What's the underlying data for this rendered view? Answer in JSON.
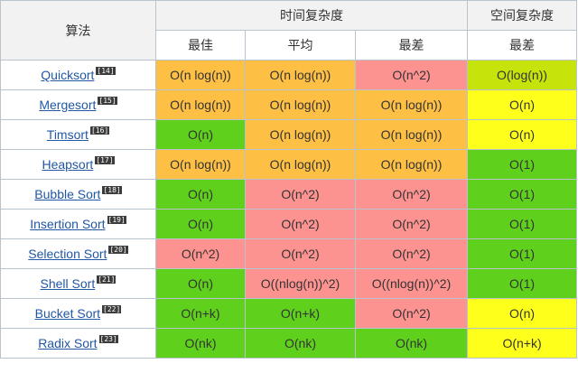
{
  "table": {
    "header": {
      "algorithm": "算法",
      "time": "时间复杂度",
      "space": "空间复杂度",
      "best": "最佳",
      "average": "平均",
      "worst": "最差",
      "space_worst": "最差"
    },
    "colors": {
      "green": "#5fd01c",
      "orange": "#fdbf44",
      "red": "#fd9391",
      "yellow": "#ffff1c",
      "lime": "#c6e40b",
      "link": "#2157a5",
      "border": "#b9c3ce"
    },
    "rows": [
      {
        "name": "Quicksort",
        "ref": "[14]",
        "cells": [
          {
            "v": "O(n log(n))",
            "c": "orange"
          },
          {
            "v": "O(n log(n))",
            "c": "orange"
          },
          {
            "v": "O(n^2)",
            "c": "red"
          },
          {
            "v": "O(log(n))",
            "c": "lime"
          }
        ]
      },
      {
        "name": "Mergesort",
        "ref": "[15]",
        "cells": [
          {
            "v": "O(n log(n))",
            "c": "orange"
          },
          {
            "v": "O(n log(n))",
            "c": "orange"
          },
          {
            "v": "O(n log(n))",
            "c": "orange"
          },
          {
            "v": "O(n)",
            "c": "yellow"
          }
        ]
      },
      {
        "name": "Timsort",
        "ref": "[16]",
        "cells": [
          {
            "v": "O(n)",
            "c": "green"
          },
          {
            "v": "O(n log(n))",
            "c": "orange"
          },
          {
            "v": "O(n log(n))",
            "c": "orange"
          },
          {
            "v": "O(n)",
            "c": "yellow"
          }
        ]
      },
      {
        "name": "Heapsort",
        "ref": "[17]",
        "cells": [
          {
            "v": "O(n log(n))",
            "c": "orange"
          },
          {
            "v": "O(n log(n))",
            "c": "orange"
          },
          {
            "v": "O(n log(n))",
            "c": "orange"
          },
          {
            "v": "O(1)",
            "c": "green"
          }
        ]
      },
      {
        "name": "Bubble Sort",
        "ref": "[18]",
        "cells": [
          {
            "v": "O(n)",
            "c": "green"
          },
          {
            "v": "O(n^2)",
            "c": "red"
          },
          {
            "v": "O(n^2)",
            "c": "red"
          },
          {
            "v": "O(1)",
            "c": "green"
          }
        ]
      },
      {
        "name": "Insertion Sort",
        "ref": "[19]",
        "cells": [
          {
            "v": "O(n)",
            "c": "green"
          },
          {
            "v": "O(n^2)",
            "c": "red"
          },
          {
            "v": "O(n^2)",
            "c": "red"
          },
          {
            "v": "O(1)",
            "c": "green"
          }
        ]
      },
      {
        "name": "Selection Sort",
        "ref": "[20]",
        "cells": [
          {
            "v": "O(n^2)",
            "c": "red"
          },
          {
            "v": "O(n^2)",
            "c": "red"
          },
          {
            "v": "O(n^2)",
            "c": "red"
          },
          {
            "v": "O(1)",
            "c": "green"
          }
        ]
      },
      {
        "name": "Shell Sort",
        "ref": "[21]",
        "cells": [
          {
            "v": "O(n)",
            "c": "green"
          },
          {
            "v": "O((nlog(n))^2)",
            "c": "red"
          },
          {
            "v": "O((nlog(n))^2)",
            "c": "red"
          },
          {
            "v": "O(1)",
            "c": "green"
          }
        ]
      },
      {
        "name": "Bucket Sort",
        "ref": "[22]",
        "cells": [
          {
            "v": "O(n+k)",
            "c": "green"
          },
          {
            "v": "O(n+k)",
            "c": "green"
          },
          {
            "v": "O(n^2)",
            "c": "red"
          },
          {
            "v": "O(n)",
            "c": "yellow"
          }
        ]
      },
      {
        "name": "Radix Sort",
        "ref": "[23]",
        "cells": [
          {
            "v": "O(nk)",
            "c": "green"
          },
          {
            "v": "O(nk)",
            "c": "green"
          },
          {
            "v": "O(nk)",
            "c": "green"
          },
          {
            "v": "O(n+k)",
            "c": "yellow"
          }
        ]
      }
    ]
  }
}
